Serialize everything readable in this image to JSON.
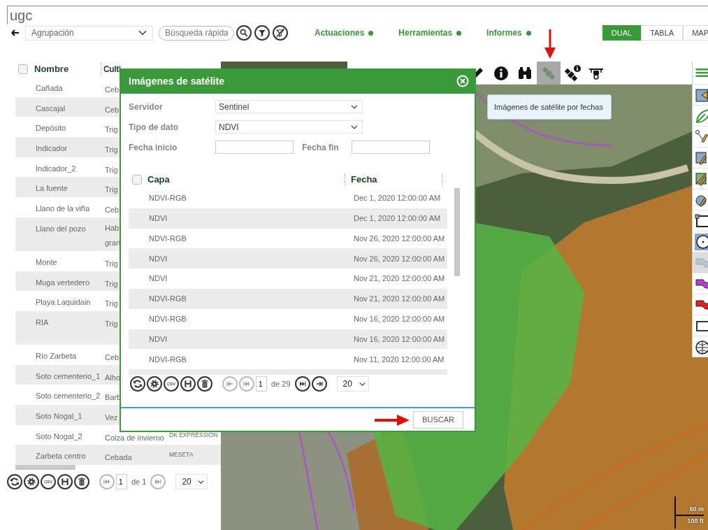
{
  "app": {
    "title": "ugc"
  },
  "toolbar": {
    "grouping": "Agrupación",
    "search_placeholder": "Búsqueda rápida",
    "menus": [
      {
        "label": "Actuaciones"
      },
      {
        "label": "Herramientas"
      },
      {
        "label": "Informes"
      }
    ],
    "views": [
      {
        "label": "DUAL",
        "selected": true
      },
      {
        "label": "TABLA",
        "selected": false
      },
      {
        "label": "MAP",
        "selected": false
      }
    ]
  },
  "table": {
    "select_all_checked": false,
    "columns": [
      "Nombre",
      "Culti"
    ],
    "rows": [
      {
        "name": "Cañada",
        "crop": "Ceb",
        "tall": false
      },
      {
        "name": "Cascajal",
        "crop": "Ceb",
        "tall": false
      },
      {
        "name": "Depósito",
        "crop": "Trig",
        "tall": false
      },
      {
        "name": "Indicador",
        "crop": "Trig",
        "tall": false
      },
      {
        "name": "Indicador_2",
        "crop": "Trig",
        "tall": false
      },
      {
        "name": "La fuente",
        "crop": "Trig",
        "tall": false
      },
      {
        "name": "Llano de la viña",
        "crop": "Ceb",
        "tall": false
      },
      {
        "name": "Llano del pozo",
        "crop": "Hab\ngran",
        "tall": true
      },
      {
        "name": "Monte",
        "crop": "Trig",
        "tall": false
      },
      {
        "name": "Muga vertedero",
        "crop": "Trig",
        "tall": false
      },
      {
        "name": "Playa Laquidain",
        "crop": "Trig",
        "tall": false
      },
      {
        "name": "RIA",
        "crop": "Trig",
        "tall": true
      },
      {
        "name": "Río Zarbeta",
        "crop": "Ceb",
        "tall": false
      },
      {
        "name": "Soto cementerio_1",
        "crop": "Alho",
        "tall": false
      },
      {
        "name": "Soto cementerio_2",
        "crop": "Barb",
        "tall": false
      },
      {
        "name": "Soto Nogal_1",
        "crop": "Vez",
        "tall": false
      },
      {
        "name": "Soto Nogal_2",
        "crop": "Colza de invierno",
        "variety": "DK EXPRESSION",
        "tall": false
      },
      {
        "name": "Zarbeta centro",
        "crop": "Cebada",
        "variety": "MESETA",
        "tall": false
      }
    ],
    "pager": {
      "export_label": "csv",
      "nav": {
        "prev": {
          "disabled": true
        },
        "next": {
          "disabled": true
        }
      },
      "page": "1",
      "total": "de 1",
      "page_size": "20"
    }
  },
  "map": {
    "toolbar": [
      {
        "selected": false
      },
      {
        "selected": false
      },
      {
        "selected": false
      },
      {
        "selected": true
      },
      {
        "selected": false
      },
      {
        "selected": false
      }
    ],
    "tools": [
      {
        "disabled": false
      },
      {
        "disabled": false
      },
      {
        "disabled": false
      },
      {
        "disabled": false
      },
      {
        "disabled": false
      },
      {
        "disabled": false
      },
      {
        "disabled": false
      },
      {
        "disabled": false
      },
      {
        "disabled": true
      },
      {
        "disabled": false
      },
      {
        "disabled": false
      },
      {
        "disabled": false
      },
      {
        "disabled": false
      }
    ],
    "tooltip": "Imágenes de satélite por fechas",
    "scale": [
      "50 m",
      "100 ft"
    ]
  },
  "dialog": {
    "title": "Imágenes de satélite",
    "fields": [
      {
        "label": "Servidor",
        "value": "Sentinel"
      },
      {
        "label": "Tipo de dato",
        "value": "NDVI"
      }
    ],
    "dates": [
      {
        "label": "Fecha inicio"
      },
      {
        "label": "Fecha fin"
      }
    ],
    "grid": {
      "select_all_checked": false,
      "columns": [
        "Capa",
        "Fecha"
      ],
      "rows": [
        {
          "layer": "NDVI-RGB",
          "date": "Dec 1, 2020 12:00:00 AM"
        },
        {
          "layer": "NDVI",
          "date": "Dec 1, 2020 12:00:00 AM"
        },
        {
          "layer": "NDVI-RGB",
          "date": "Nov 26, 2020 12:00:00 AM"
        },
        {
          "layer": "NDVI",
          "date": "Nov 26, 2020 12:00:00 AM"
        },
        {
          "layer": "NDVI",
          "date": "Nov 21, 2020 12:00:00 AM"
        },
        {
          "layer": "NDVI-RGB",
          "date": "Nov 21, 2020 12:00:00 AM"
        },
        {
          "layer": "NDVI-RGB",
          "date": "Nov 16, 2020 12:00:00 AM"
        },
        {
          "layer": "NDVI",
          "date": "Nov 16, 2020 12:00:00 AM"
        },
        {
          "layer": "NDVI-RGB",
          "date": "Nov 11, 2020 12:00:00 AM"
        }
      ]
    },
    "pager": {
      "export_label": "csv",
      "nav": {
        "first": {
          "disabled": true
        },
        "prev": {
          "disabled": true
        },
        "next": {
          "disabled": false
        },
        "last": {
          "disabled": false
        }
      },
      "page": "1",
      "total": "de 29",
      "page_size": "20"
    },
    "button": "BUSCAR"
  }
}
